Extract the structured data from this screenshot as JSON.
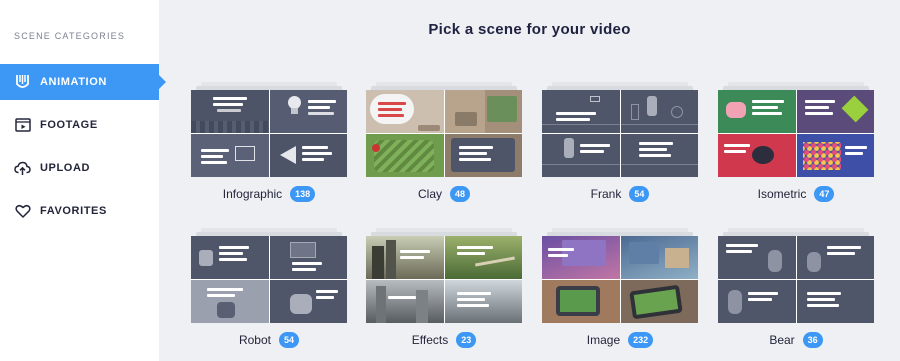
{
  "sidebar": {
    "heading": "SCENE CATEGORIES",
    "items": [
      {
        "label": "ANIMATION",
        "icon": "animation-icon",
        "active": true
      },
      {
        "label": "FOOTAGE",
        "icon": "film-icon",
        "active": false
      },
      {
        "label": "UPLOAD",
        "icon": "upload-cloud-icon",
        "active": false
      },
      {
        "label": "FAVORITES",
        "icon": "heart-icon",
        "active": false
      }
    ]
  },
  "main": {
    "title": "Pick a scene for your video",
    "cards": [
      {
        "name": "Infographic",
        "count": "138"
      },
      {
        "name": "Clay",
        "count": "48"
      },
      {
        "name": "Frank",
        "count": "54"
      },
      {
        "name": "Isometric",
        "count": "47"
      },
      {
        "name": "Robot",
        "count": "54"
      },
      {
        "name": "Effects",
        "count": "23"
      },
      {
        "name": "Image",
        "count": "232"
      },
      {
        "name": "Bear",
        "count": "36"
      }
    ]
  },
  "colors": {
    "accent": "#3d97f4",
    "sidebar_bg": "#ffffff",
    "main_bg": "#eef0f3",
    "text_dark": "#23263b"
  }
}
